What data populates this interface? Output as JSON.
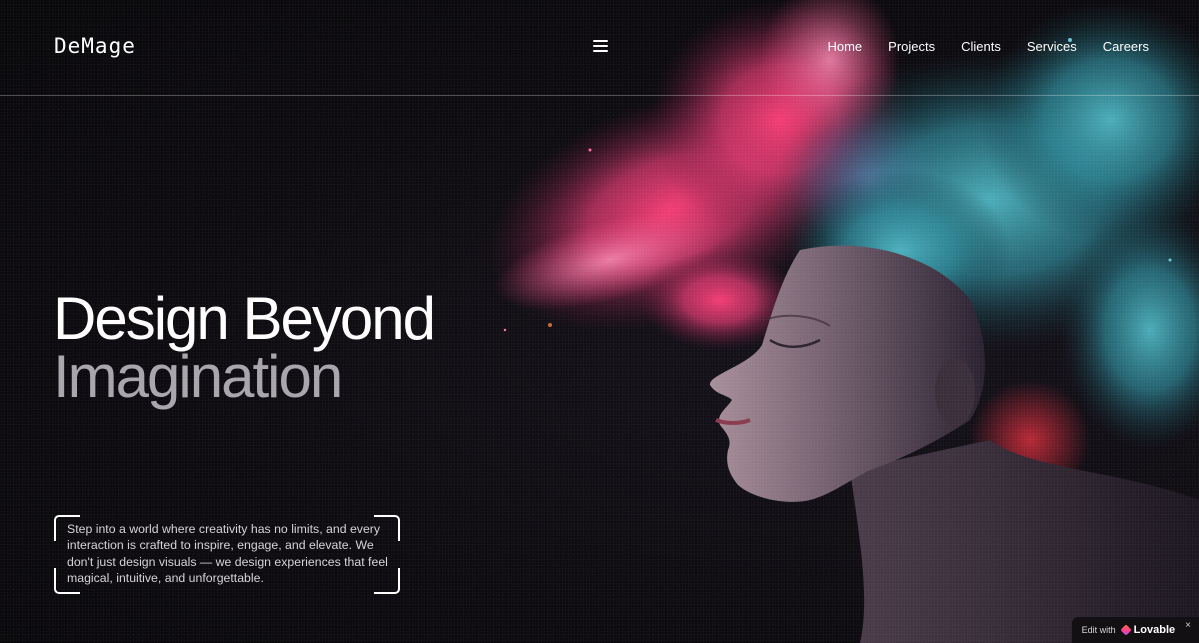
{
  "brand": {
    "logo_text": "DeMage"
  },
  "header": {
    "menu_icon": "hamburger-menu-icon",
    "nav_items": [
      {
        "label": "Home"
      },
      {
        "label": "Projects"
      },
      {
        "label": "Clients"
      },
      {
        "label": "Services"
      },
      {
        "label": "Careers"
      }
    ]
  },
  "hero": {
    "headline_line1": "Design Beyond",
    "headline_line2": "Imagination",
    "intro_text": "Step into a world where creativity has no limits, and every interaction is crafted to inspire, engage, and elevate. We don't just design visuals — we design experiences that feel magical, intuitive, and unforgettable.",
    "image": "woman-profile-with-exploding-pink-and-teal-powder-hair"
  },
  "badge": {
    "prefix": "Edit with",
    "brand": "Lovable",
    "close": "×",
    "icon": "lovable-heart-icon"
  },
  "colors": {
    "background": "#0c0a0e",
    "text_primary": "#ffffff",
    "text_secondary": "#a9a7ad",
    "powder_pink": "#ff4f8a",
    "powder_teal": "#3fa6b4"
  }
}
